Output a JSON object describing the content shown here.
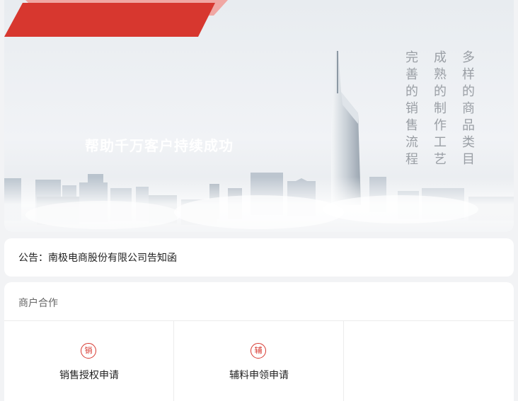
{
  "banner": {
    "headline": "帮助千万客户持续成功",
    "columns": [
      "多样的商品类目",
      "成熟的制作工艺",
      "完善的销售流程"
    ],
    "accent_color": "#d7372f"
  },
  "notice": {
    "text": "公告：南极电商股份有限公司告知函"
  },
  "cooperation": {
    "title": "商户合作",
    "items": [
      {
        "icon_text": "销",
        "label": "销售授权申请",
        "icon": "sales-icon"
      },
      {
        "icon_text": "辅",
        "label": "辅料申领申请",
        "icon": "materials-icon"
      }
    ]
  }
}
